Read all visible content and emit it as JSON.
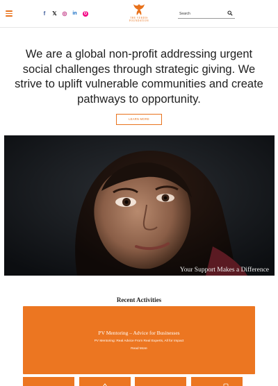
{
  "header": {
    "menu_icon": "hamburger-icon",
    "socials": [
      {
        "icon": "facebook-icon",
        "glyph": "f"
      },
      {
        "icon": "x-icon",
        "glyph": "𝕏"
      },
      {
        "icon": "instagram-icon",
        "glyph": "◎"
      },
      {
        "icon": "linkedin-icon",
        "glyph": "in"
      },
      {
        "icon": "g-icon",
        "glyph": "G"
      }
    ],
    "logo_line1": "THE VERDIS",
    "logo_line2": "FOUNDATION",
    "search_placeholder": "Search",
    "search_icon": "search-icon"
  },
  "hero": {
    "text": "We are a global non-profit addressing urgent social challenges through strategic giving. We strive to uplift vulnerable communities and create pathways to opportunity.",
    "button_label": "LEARN MORE"
  },
  "photo": {
    "caption": "Your Support Makes a Difference"
  },
  "activities": {
    "title": "Recent Activities",
    "card": {
      "title": "PV Mentoring – Advice for Businesses",
      "description": "PV Mentoring: Real Advice From Real Experts, All for Impact",
      "link": "Read More"
    }
  },
  "colors": {
    "accent": "#ec7621",
    "brand_orange": "#e8721c"
  }
}
